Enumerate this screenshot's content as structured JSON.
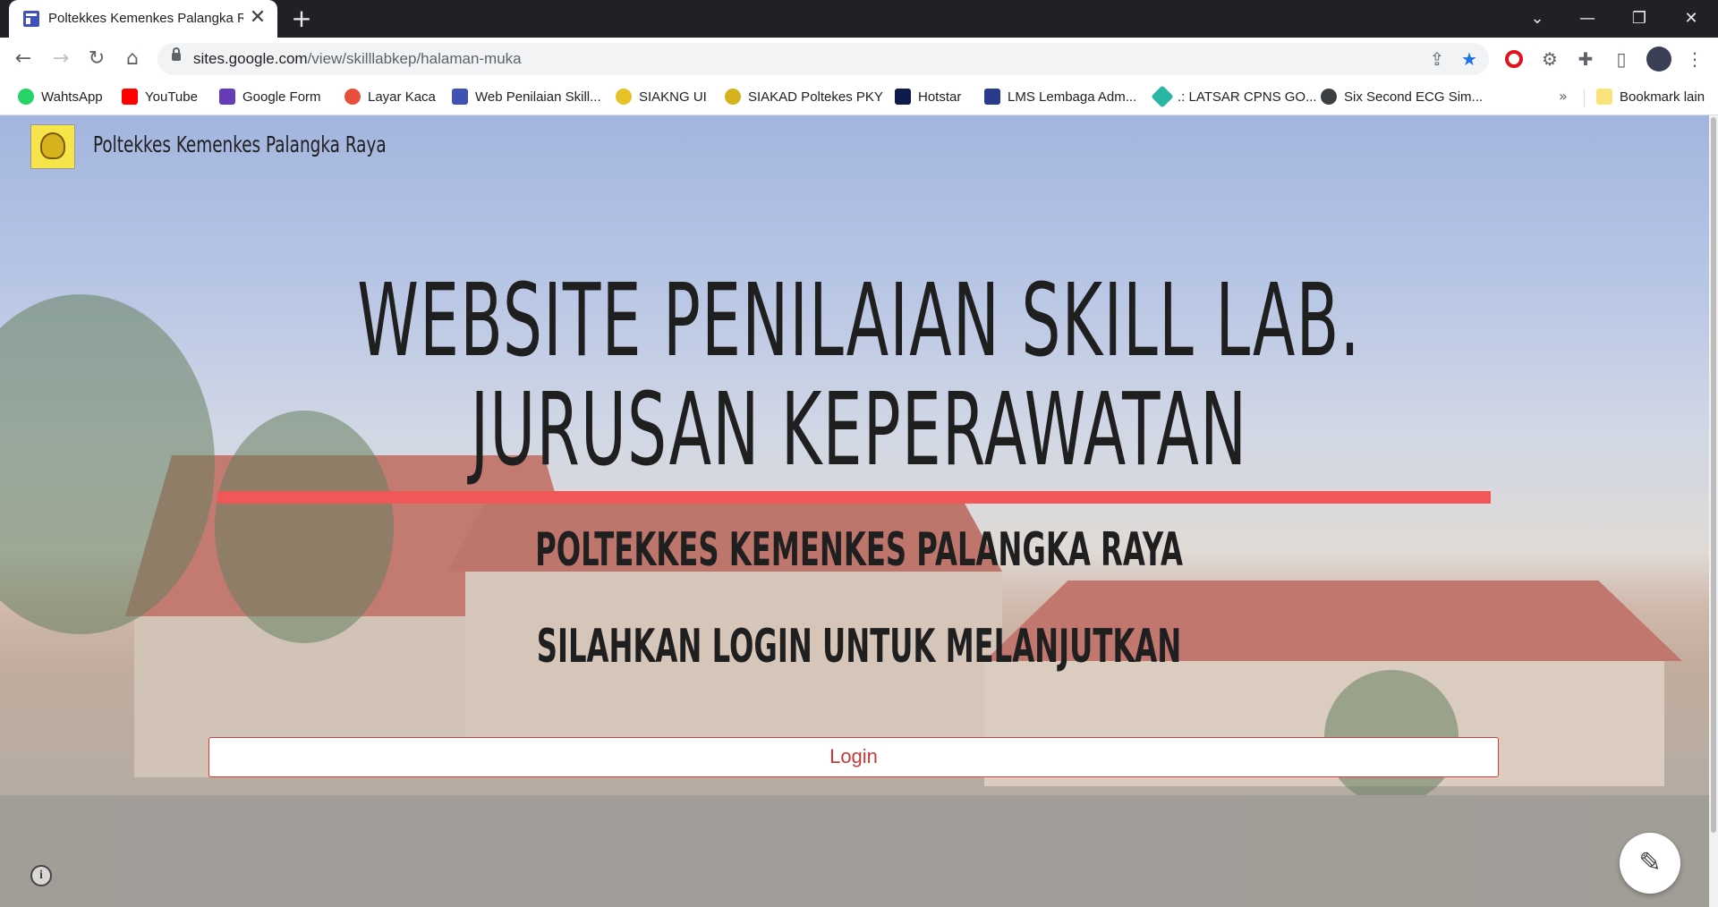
{
  "browser": {
    "tab_title": "Poltekkes Kemenkes Palangka Raya",
    "tab_close_glyph": "✕",
    "new_tab_glyph": "+",
    "url_host": "sites.google.com",
    "url_path": "/view/skilllabkep/halaman-muka",
    "window_controls": {
      "dropdown": "⌄",
      "minimize": "—",
      "restore": "❐",
      "close": "✕"
    },
    "nav": {
      "back": "←",
      "forward": "→",
      "reload": "↻",
      "home": "⌂"
    }
  },
  "bookmarks": [
    {
      "label": "WahtsApp",
      "icon": "whatsapp-icon",
      "color": "#25d366"
    },
    {
      "label": "YouTube",
      "icon": "youtube-icon",
      "color": "#ff0000"
    },
    {
      "label": "Google Form",
      "icon": "google-forms-icon",
      "color": "#673ab7"
    },
    {
      "label": "Layar Kaca",
      "icon": "layar-kaca-icon",
      "color": "#e94e3c"
    },
    {
      "label": "Web Penilaian Skill...",
      "icon": "google-sites-icon",
      "color": "#3f51b5"
    },
    {
      "label": "SIAKNG UI",
      "icon": "ui-logo-icon",
      "color": "#e6c229"
    },
    {
      "label": "SIAKAD Poltekes PKY",
      "icon": "poltekkes-logo-icon",
      "color": "#d6b21e"
    },
    {
      "label": "Hotstar",
      "icon": "hotstar-icon",
      "color": "#0f1b4c"
    },
    {
      "label": "LMS Lembaga Adm...",
      "icon": "lan-logo-icon",
      "color": "#2a3a8c"
    },
    {
      "label": ".: LATSAR CPNS GO...",
      "icon": "latsar-icon",
      "color": "#29b6a4"
    },
    {
      "label": "Six Second ECG Sim...",
      "icon": "ecg-icon",
      "color": "#3c4043"
    }
  ],
  "bookmarks_overflow": "»",
  "bookmarks_other": "Bookmark lain",
  "site": {
    "title": "Poltekkes Kemenkes Palangka Raya",
    "heading_line1": "WEBSITE PENILAIAN SKILL LAB.",
    "heading_line2": "JURUSAN KEPERAWATAN",
    "subheading": "POLTEKKES KEMENKES PALANGKA RAYA",
    "instruction": "SILAHKAN LOGIN UNTUK MELANJUTKAN",
    "login_label": "Login",
    "info_glyph": "i",
    "edit_glyph": "✎",
    "accent_color": "#f25757"
  }
}
